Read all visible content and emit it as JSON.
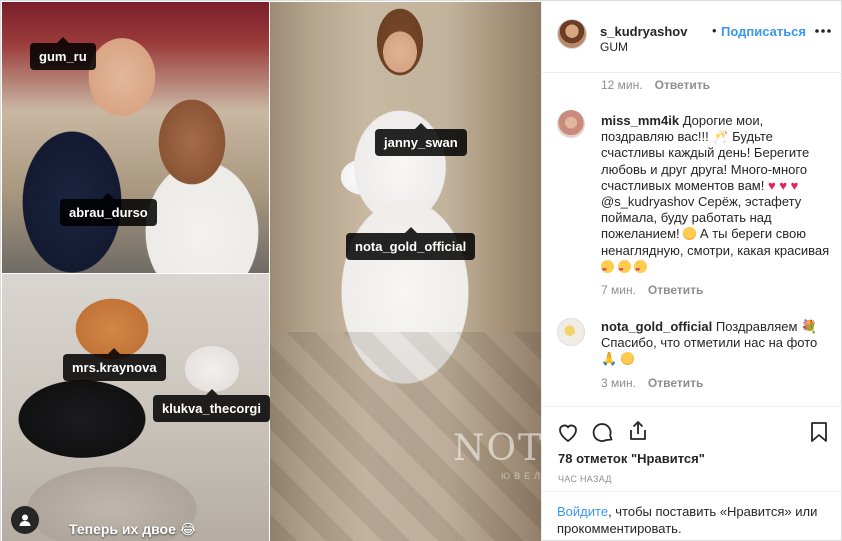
{
  "header": {
    "username": "s_kudryashov",
    "separator": "•",
    "follow_label": "Подписаться",
    "location": "GUM",
    "more_icon": "ellipsis-icon"
  },
  "media": {
    "tags": [
      "gum_ru",
      "abrau_durso",
      "mrs.kraynova",
      "klukva_thecorgi",
      "janny_swan",
      "nota_gold_official"
    ],
    "caption": "Теперь их двое 😂",
    "watermark": "NOTA",
    "watermark_sub": "ЮВЕЛИ",
    "user_icon": "user-tag-icon"
  },
  "comments": [
    {
      "meta_time": "12 мин.",
      "reply_label": "Ответить"
    },
    {
      "username": "miss_mm4ik",
      "text_a": "Дорогие мои, поздравляю вас!!! 🥂 Будьте счастливы каждый день! Берегите любовь и друг друга! Много-много счастливых моментов вам!",
      "hearts": "♥ ♥ ♥",
      "text_b": "@s_kudryashov Серёж, эстафету поймала, буду работать над пожеланием!",
      "text_c": "А ты береги свою ненаглядную, смотри, какая красивая",
      "time": "7 мин.",
      "reply_label": "Ответить"
    },
    {
      "username": "nota_gold_official",
      "text_a": "Поздравляем 💐 Спасибо, что отметили нас на фото",
      "text_b": "🙏",
      "time": "3 мин.",
      "reply_label": "Ответить"
    }
  ],
  "actions": {
    "like_icon": "heart-icon",
    "comment_icon": "comment-icon",
    "share_icon": "share-icon",
    "save_icon": "bookmark-icon",
    "likes_text": "78 отметок \"Нравится\"",
    "date_text": "ЧАС НАЗАД"
  },
  "login": {
    "link_label": "Войдите",
    "rest": ", чтобы поставить «Нравится» или прокомментировать."
  },
  "colors": {
    "link": "#3897f0",
    "muted": "#8e8e8e",
    "heart": "#e0245e"
  }
}
